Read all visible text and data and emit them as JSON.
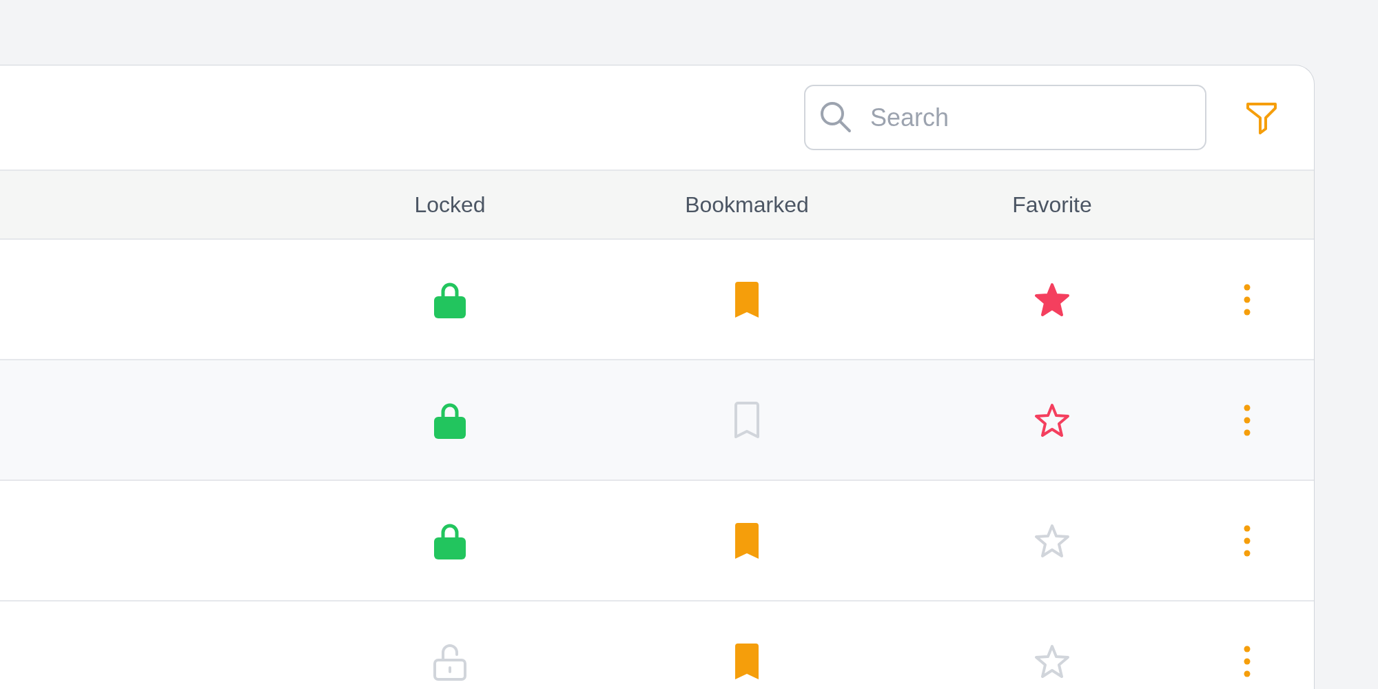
{
  "search": {
    "placeholder": "Search"
  },
  "table": {
    "columns": [
      "Locked",
      "Bookmarked",
      "Favorite"
    ],
    "rows": [
      {
        "locked": true,
        "bookmarked": true,
        "favorite": true,
        "hovered": false
      },
      {
        "locked": true,
        "bookmarked": false,
        "favorite": false,
        "hovered": true
      },
      {
        "locked": true,
        "bookmarked": true,
        "favorite": false,
        "hovered": false
      },
      {
        "locked": false,
        "bookmarked": true,
        "favorite": false,
        "hovered": false
      }
    ]
  }
}
